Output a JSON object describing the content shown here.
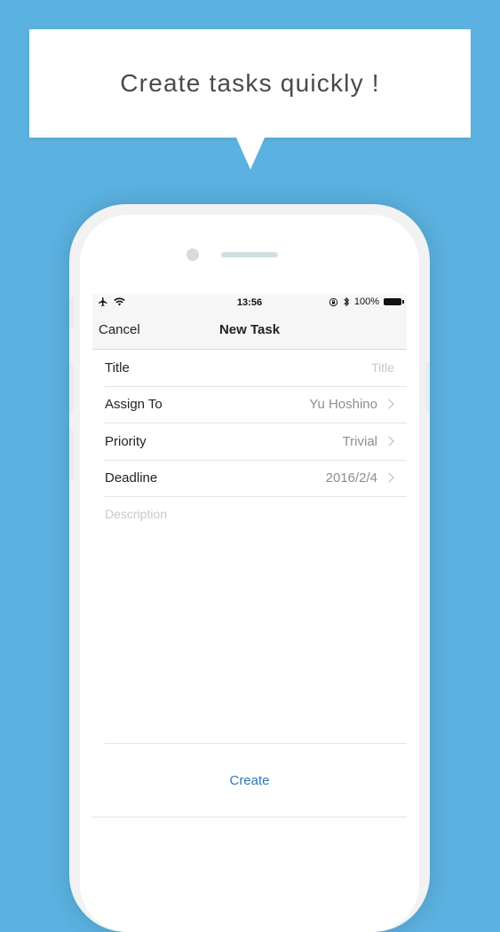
{
  "banner": {
    "text": "Create tasks quickly !"
  },
  "status_bar": {
    "time": "13:56",
    "battery": "100%"
  },
  "nav": {
    "cancel_label": "Cancel",
    "title": "New Task"
  },
  "form": {
    "title": {
      "label": "Title",
      "placeholder": "Title"
    },
    "assign_to": {
      "label": "Assign To",
      "value": "Yu Hoshino"
    },
    "priority": {
      "label": "Priority",
      "value": "Trivial"
    },
    "deadline": {
      "label": "Deadline",
      "value": "2016/2/4"
    },
    "description": {
      "placeholder": "Description"
    }
  },
  "actions": {
    "create_label": "Create"
  },
  "colors": {
    "background": "#5bb1df",
    "accent": "#2f77b6"
  },
  "icons": [
    "airplane-icon",
    "wifi-icon",
    "orientation-lock-icon",
    "bluetooth-icon",
    "battery-icon",
    "chevron-right-icon"
  ]
}
